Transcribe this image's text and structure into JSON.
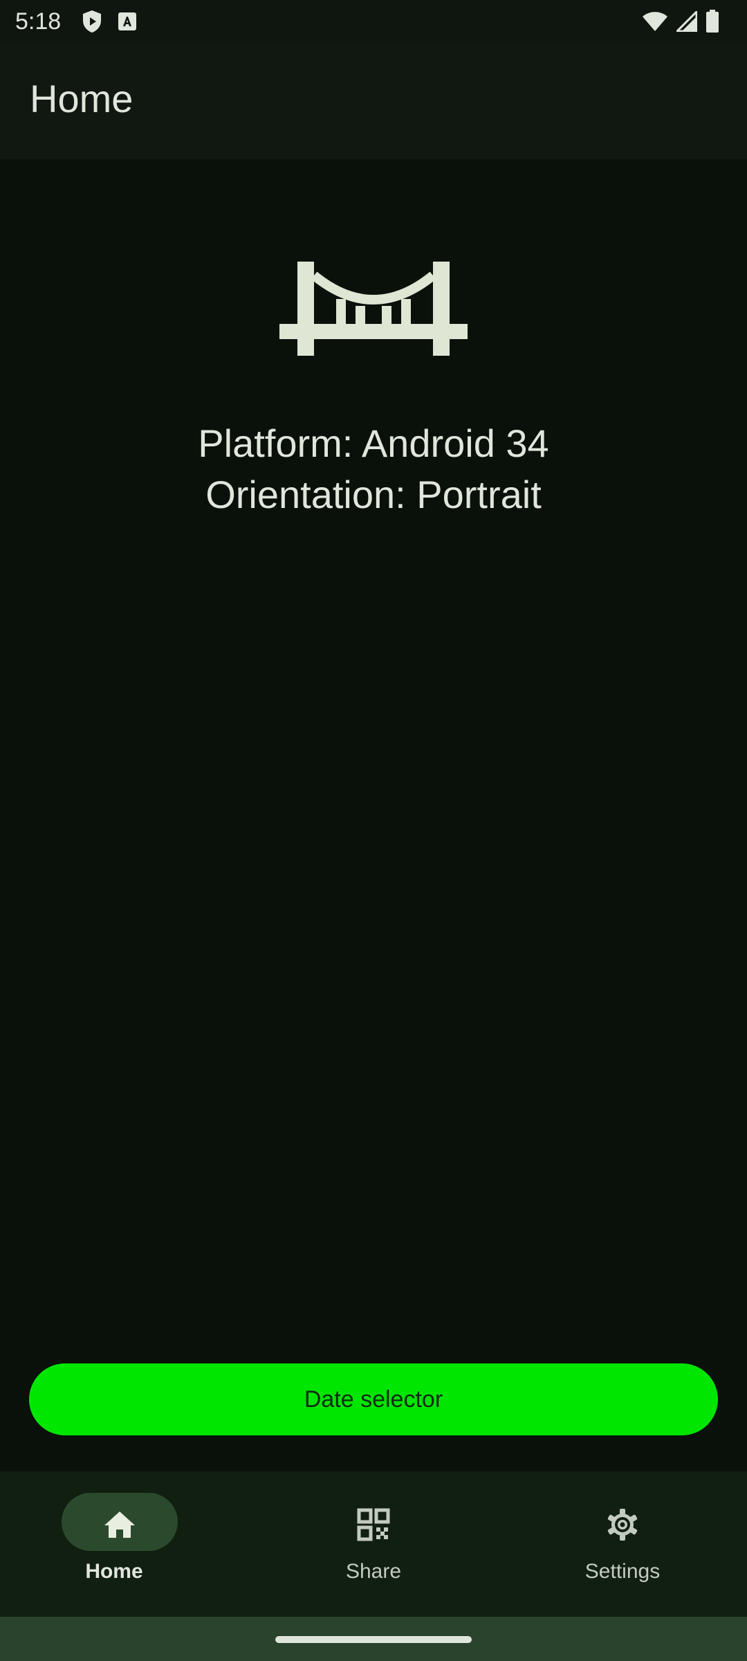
{
  "status_bar": {
    "time": "5:18",
    "left_icons": [
      "shield-play-icon",
      "font-a-icon"
    ],
    "right_icons": [
      "wifi-icon",
      "signal-icon",
      "battery-icon"
    ]
  },
  "app_bar": {
    "title": "Home"
  },
  "main": {
    "icon": "bridge-icon",
    "platform_text": "Platform: Android 34",
    "orientation_text": "Orientation: Portrait",
    "date_button_label": "Date selector"
  },
  "bottom_nav": {
    "items": [
      {
        "label": "Home",
        "icon": "home-icon",
        "selected": true
      },
      {
        "label": "Share",
        "icon": "qr-code-icon",
        "selected": false
      },
      {
        "label": "Settings",
        "icon": "gear-icon",
        "selected": false
      }
    ]
  },
  "colors": {
    "background": "#0a110b",
    "app_bar": "#111811",
    "accent_button": "#00e600",
    "nav_background": "#111f11",
    "nav_indicator": "#2b4a2d",
    "text_primary": "#e1e6dc"
  }
}
